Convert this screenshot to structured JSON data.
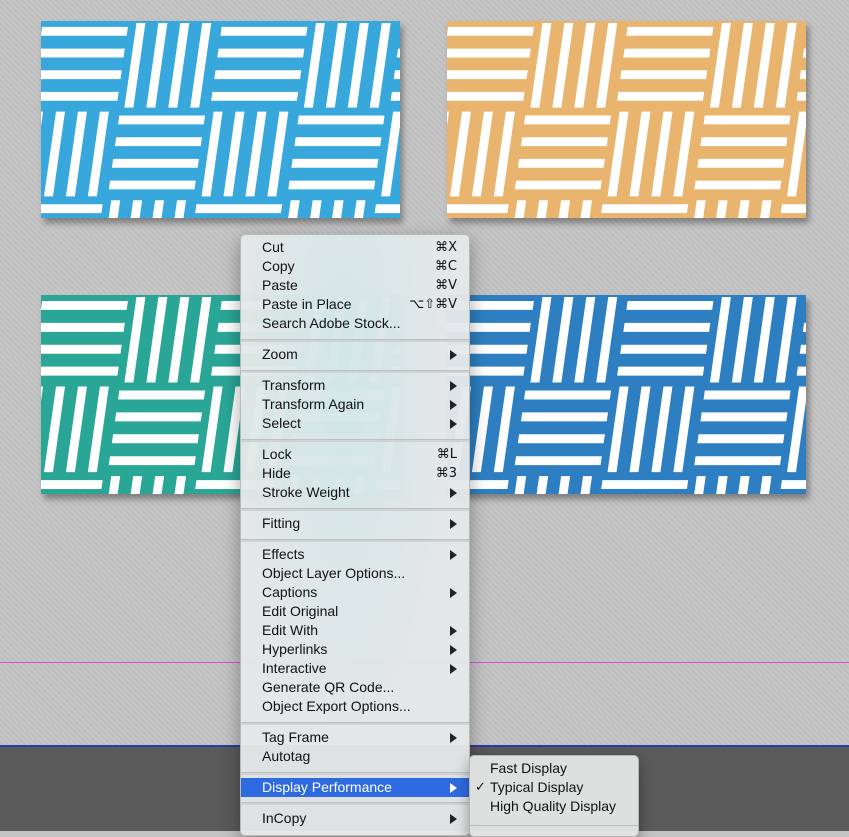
{
  "colors": {
    "card_blue": "#37a7dc",
    "card_orange": "#e8b46e",
    "card_teal": "#2aa697",
    "card_darkblue": "#2e7fc1",
    "selection": "#2f6be0",
    "margin_guide": "#d94fd9",
    "bleed_guide": "#2c3aa8"
  },
  "context_menu": {
    "items": [
      {
        "label": "Cut",
        "shortcut": "⌘X"
      },
      {
        "label": "Copy",
        "shortcut": "⌘C"
      },
      {
        "label": "Paste",
        "shortcut": "⌘V"
      },
      {
        "label": "Paste in Place",
        "shortcut": "⌥⇧⌘V"
      },
      {
        "label": "Search Adobe Stock..."
      },
      {
        "label": "Zoom"
      },
      {
        "label": "Transform"
      },
      {
        "label": "Transform Again"
      },
      {
        "label": "Select"
      },
      {
        "label": "Lock",
        "shortcut": "⌘L"
      },
      {
        "label": "Hide",
        "shortcut": "⌘3"
      },
      {
        "label": "Stroke Weight"
      },
      {
        "label": "Fitting"
      },
      {
        "label": "Effects"
      },
      {
        "label": "Object Layer Options..."
      },
      {
        "label": "Captions"
      },
      {
        "label": "Edit Original"
      },
      {
        "label": "Edit With"
      },
      {
        "label": "Hyperlinks"
      },
      {
        "label": "Interactive"
      },
      {
        "label": "Generate QR Code..."
      },
      {
        "label": "Object Export Options..."
      },
      {
        "label": "Tag Frame"
      },
      {
        "label": "Autotag"
      },
      {
        "label": "Display Performance",
        "selected": true
      },
      {
        "label": "InCopy"
      }
    ]
  },
  "display_performance_submenu": {
    "items": [
      {
        "label": "Fast Display"
      },
      {
        "label": "Typical Display",
        "checked": true,
        "check": "✓"
      },
      {
        "label": "High Quality Display"
      }
    ]
  }
}
